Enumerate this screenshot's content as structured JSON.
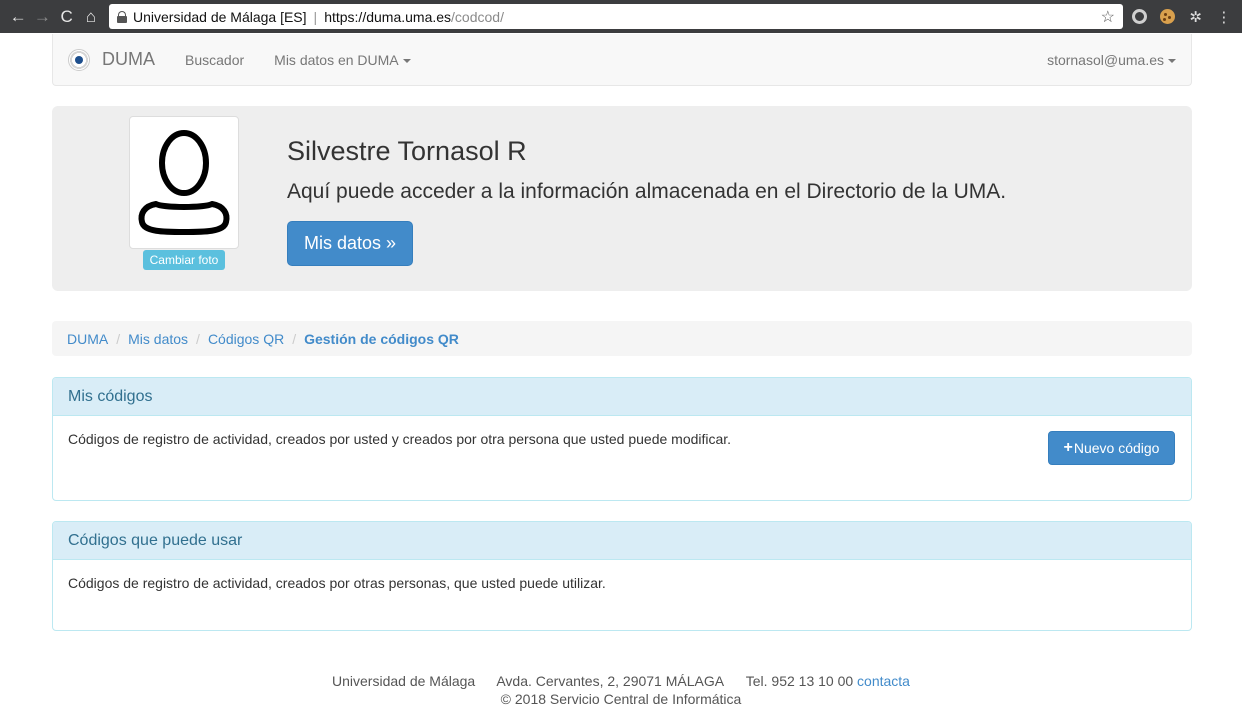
{
  "browser": {
    "org": "Universidad de Málaga [ES]",
    "url_host": "https://duma.uma.es",
    "url_path": "/codcod/",
    "back_glyph": "←",
    "forward_glyph": "→",
    "reload_glyph": "C",
    "home_glyph": "⌂",
    "star_glyph": "☆",
    "menu_glyph": "⋮",
    "gear_glyph": "✲"
  },
  "navbar": {
    "brand": "DUMA",
    "search_link": "Buscador",
    "mydata_menu": "Mis datos en DUMA",
    "user_menu": "stornasol@uma.es"
  },
  "profile": {
    "name": "Silvestre Tornasol R",
    "lead": "Aquí puede acceder a la información almacenada en el Directorio de la UMA.",
    "change_photo": "Cambiar foto",
    "my_data_button": "Mis datos »"
  },
  "breadcrumb": {
    "items": [
      "DUMA",
      "Mis datos",
      "Códigos QR"
    ],
    "active": "Gestión de códigos QR",
    "divider": "/"
  },
  "panels": {
    "my_codes": {
      "title": "Mis códigos",
      "text": "Códigos de registro de actividad, creados por usted y creados por otra persona que usted puede modificar.",
      "new_button": "Nuevo código",
      "new_button_icon": "+"
    },
    "usable_codes": {
      "title": "Códigos que puede usar",
      "text": "Códigos de registro de actividad, creados por otras personas, que usted puede utilizar."
    }
  },
  "footer": {
    "org": "Universidad de Málaga",
    "address": "Avda. Cervantes, 2, 29071 MÁLAGA",
    "phone": "Tel. 952 13 10 00",
    "contact_link": "contacta",
    "copyright": "© 2018 Servicio Central de Informática"
  },
  "colors": {
    "primary": "#428bca",
    "info_panel": "#d9edf7",
    "info_button": "#5bc0de"
  }
}
